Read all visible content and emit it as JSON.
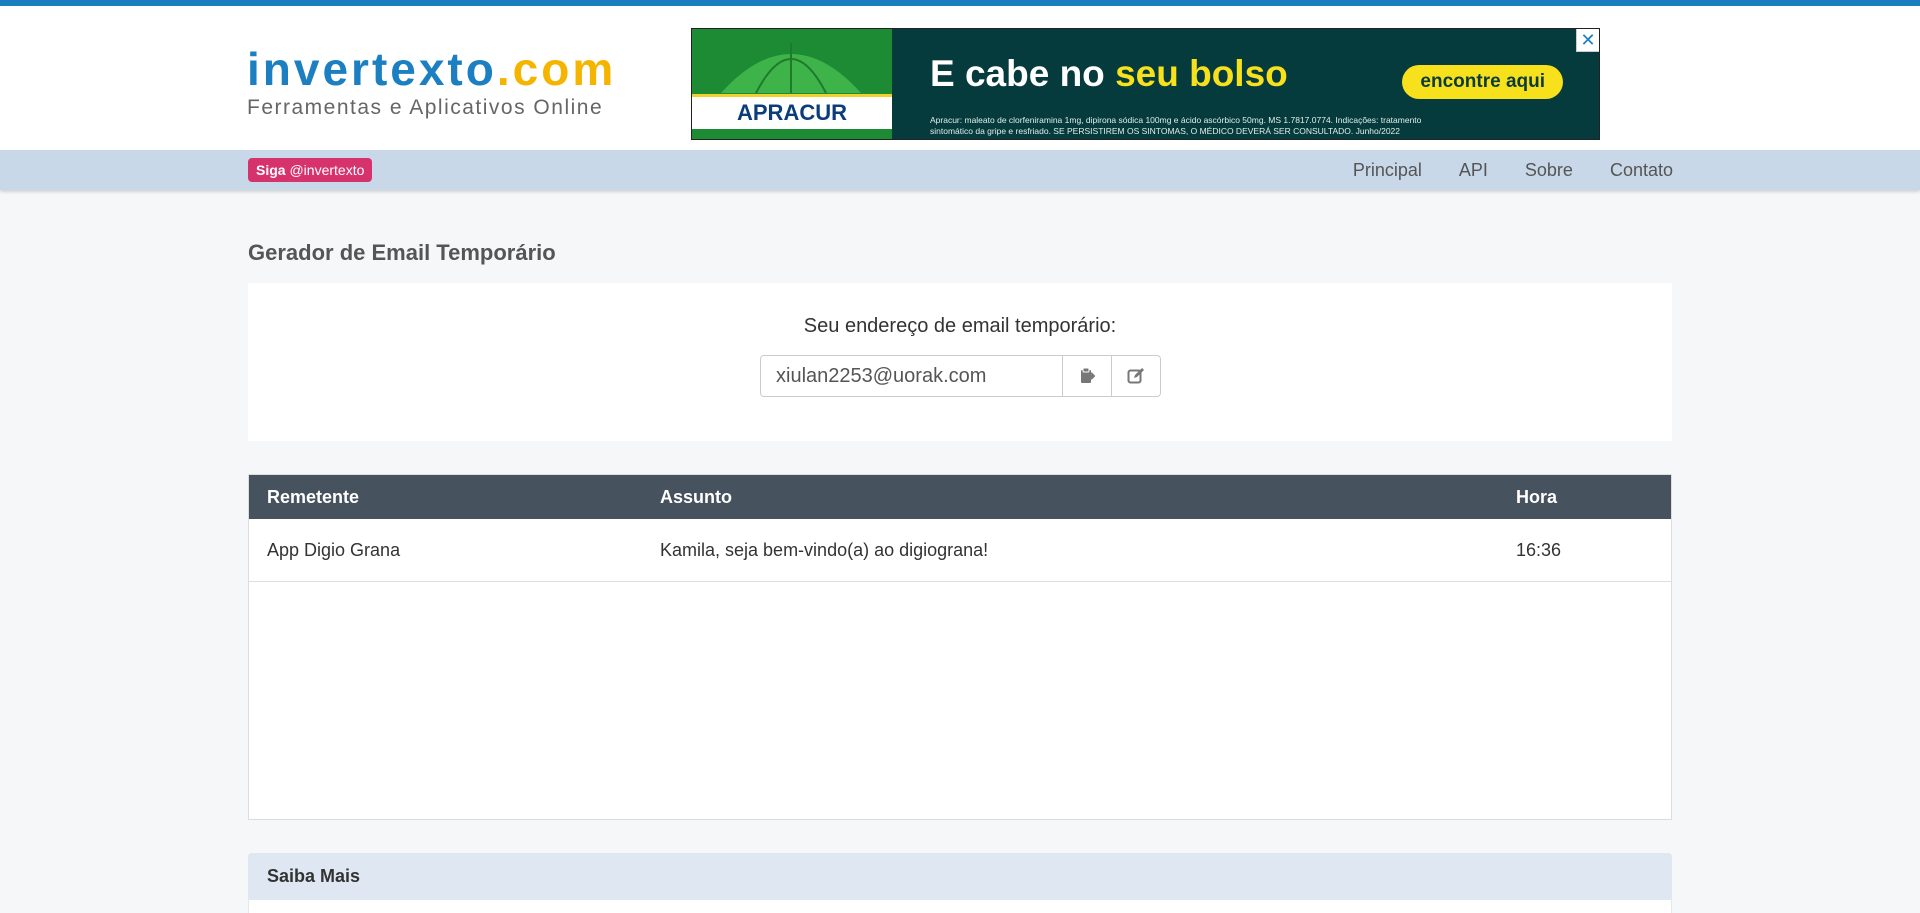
{
  "colors": {
    "accent": "#1b7fc2",
    "logo_dot": "#f4b400",
    "badge": "#d6336c",
    "navbar": "#c8d8e8",
    "table_header": "#46525e"
  },
  "logo": {
    "main": "invertexto",
    "dot": ".com",
    "tagline": "Ferramentas e Aplicativos Online"
  },
  "ad": {
    "brand": "APRACUR",
    "headline_start": "E cabe no ",
    "headline_highlight": "seu bolso",
    "cta": "encontre aqui",
    "fine_print": "Apracur: maleato de clorfeniramina 1mg, dipirona sódica 100mg e ácido ascórbico 50mg. MS 1.7817.0774. Indicações: tratamento sintomático da gripe e resfriado. SE PERSISTIREM OS SINTOMAS, O MÉDICO DEVERÁ SER CONSULTADO. Junho/2022",
    "close_icon": "close-icon"
  },
  "nav": {
    "follow_bold": "Siga",
    "follow_handle": "@invertexto",
    "links": [
      "Principal",
      "API",
      "Sobre",
      "Contato"
    ]
  },
  "page": {
    "title": "Gerador de Email Temporário"
  },
  "email": {
    "label": "Seu endereço de email temporário:",
    "address": "xiulan2253@uorak.com",
    "copy_icon": "clipboard-icon",
    "edit_icon": "edit-icon"
  },
  "inbox": {
    "columns": [
      "Remetente",
      "Assunto",
      "Hora"
    ],
    "rows": [
      {
        "sender": "App Digio Grana",
        "subject": "Kamila, seja bem-vindo(a) ao digiograna!",
        "time": "16:36"
      }
    ]
  },
  "saiba": {
    "title": "Saiba Mais"
  }
}
